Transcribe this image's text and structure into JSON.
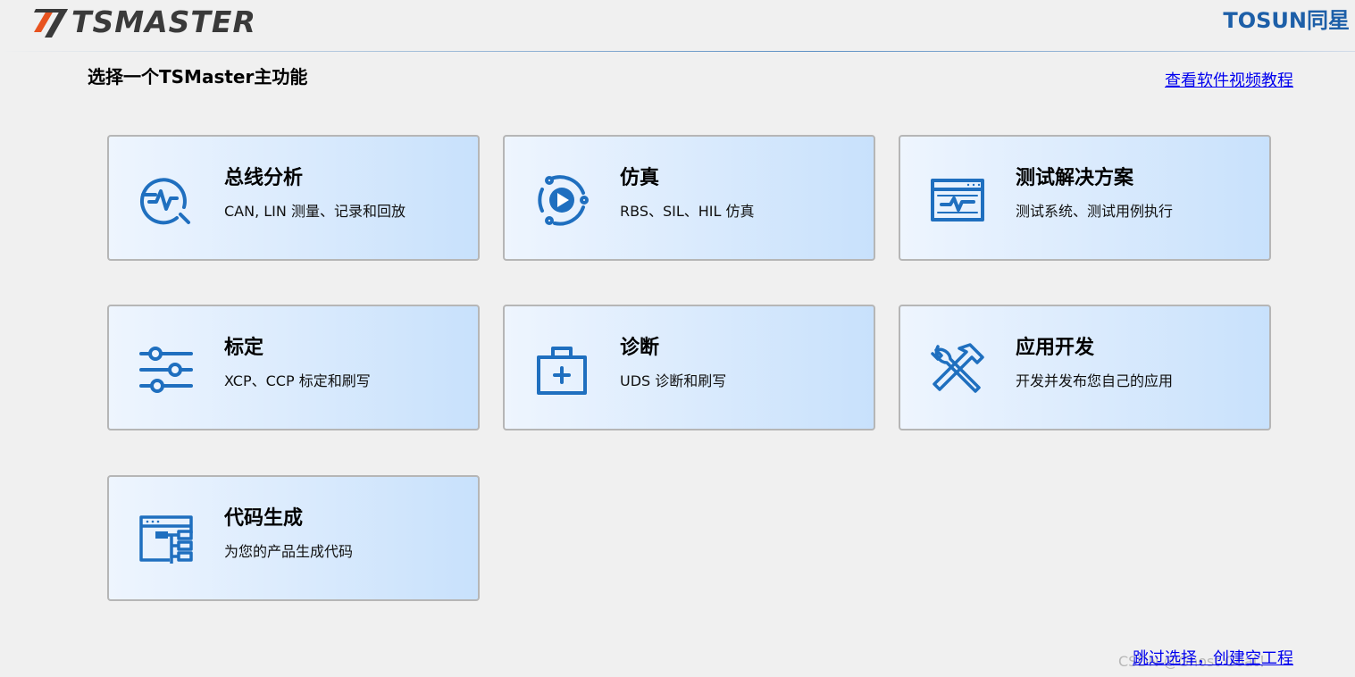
{
  "brand": {
    "logo_left": "TSMASTER",
    "logo_right": "TOSUN同星"
  },
  "page": {
    "title": "选择一个TSMaster主功能"
  },
  "links": {
    "tutorial": "查看软件视频教程",
    "skip": "跳过选择，创建空工程"
  },
  "watermark": "CSDN @Ghost Goat！",
  "colors": {
    "accent": "#1f6fbf",
    "card_gradient_start": "#eef5fe",
    "card_gradient_end": "#c8e1fc",
    "link": "#0000ee"
  },
  "cards": [
    {
      "title": "总线分析",
      "desc": "CAN, LIN 测量、记录和回放",
      "icon": "bus-analysis-icon"
    },
    {
      "title": "仿真",
      "desc": "RBS、SIL、HIL 仿真",
      "icon": "simulation-play-icon"
    },
    {
      "title": "测试解决方案",
      "desc": "测试系统、测试用例执行",
      "icon": "test-monitor-icon"
    },
    {
      "title": "标定",
      "desc": "XCP、CCP 标定和刷写",
      "icon": "calibration-sliders-icon"
    },
    {
      "title": "诊断",
      "desc": "UDS 诊断和刷写",
      "icon": "diagnosis-medkit-icon"
    },
    {
      "title": "应用开发",
      "desc": "开发并发布您自己的应用",
      "icon": "tools-icon"
    },
    {
      "title": "代码生成",
      "desc": "为您的产品生成代码",
      "icon": "code-generation-icon"
    }
  ]
}
